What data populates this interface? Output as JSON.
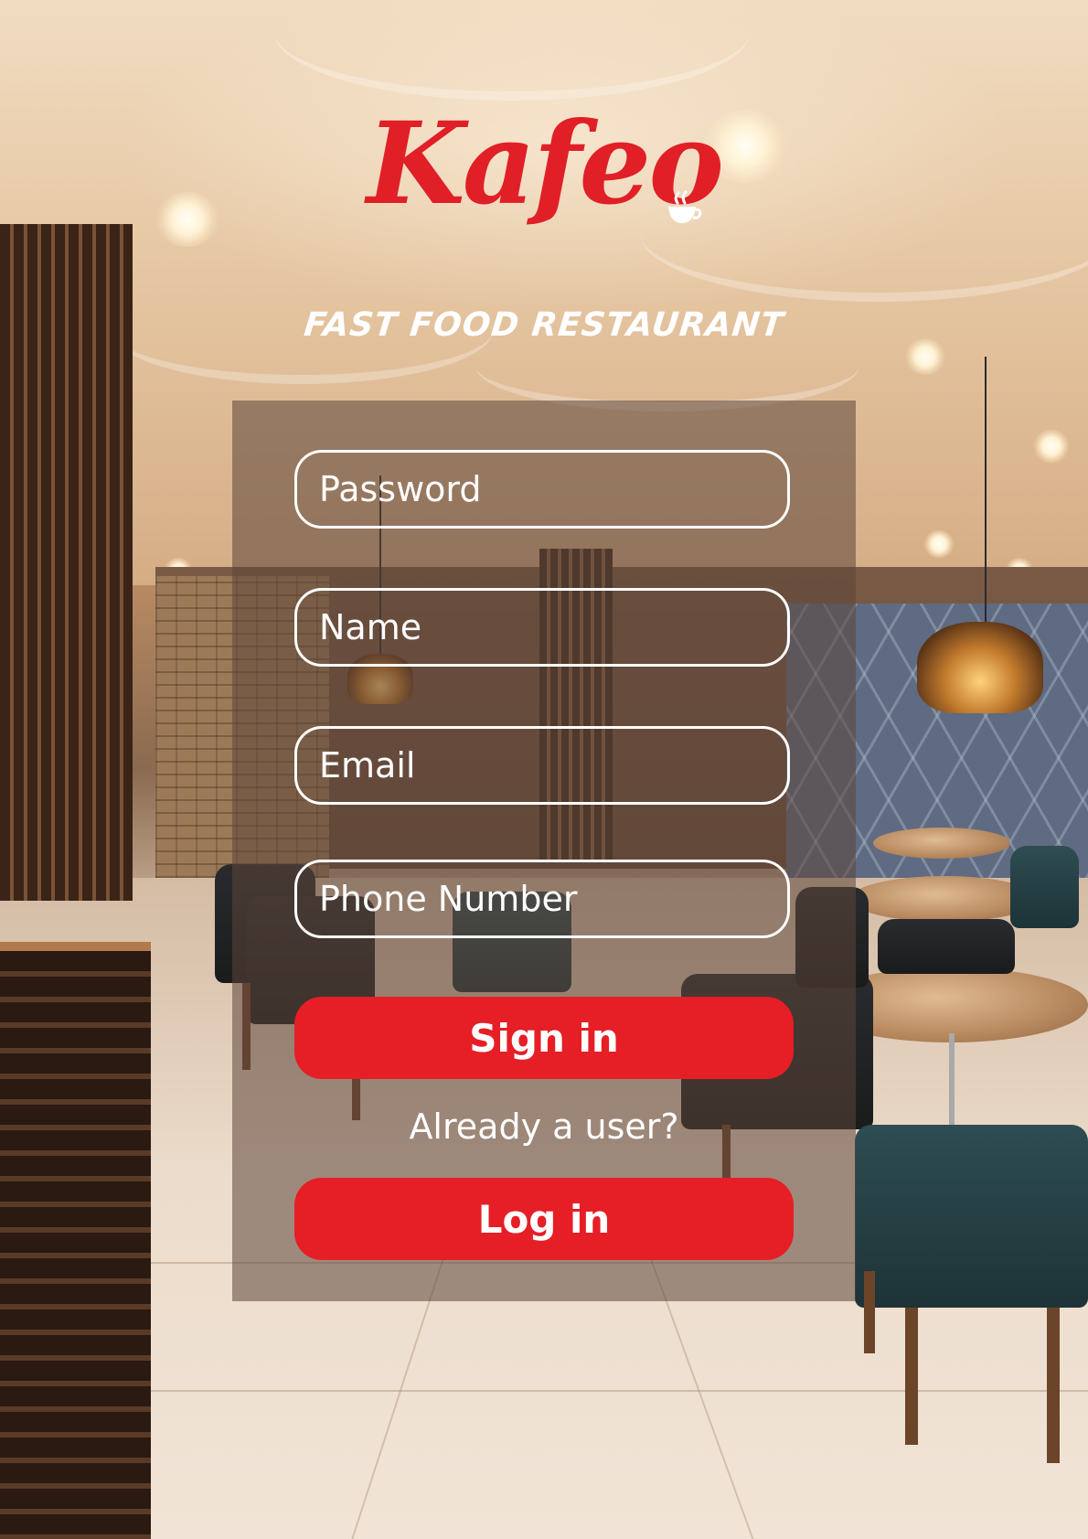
{
  "brand": {
    "name": "Kafeo",
    "tagline": "FAST FOOD RESTAURANT",
    "logo_icon": "coffee-cup-icon",
    "brand_color": "#e11f27"
  },
  "form": {
    "fields": [
      {
        "placeholder": "Password"
      },
      {
        "placeholder": "Name"
      },
      {
        "placeholder": "Email"
      },
      {
        "placeholder": "Phone Number"
      }
    ],
    "sign_in_label": "Sign in",
    "already_user_text": "Already a user?",
    "log_in_label": "Log in",
    "button_color": "#e61e26"
  }
}
